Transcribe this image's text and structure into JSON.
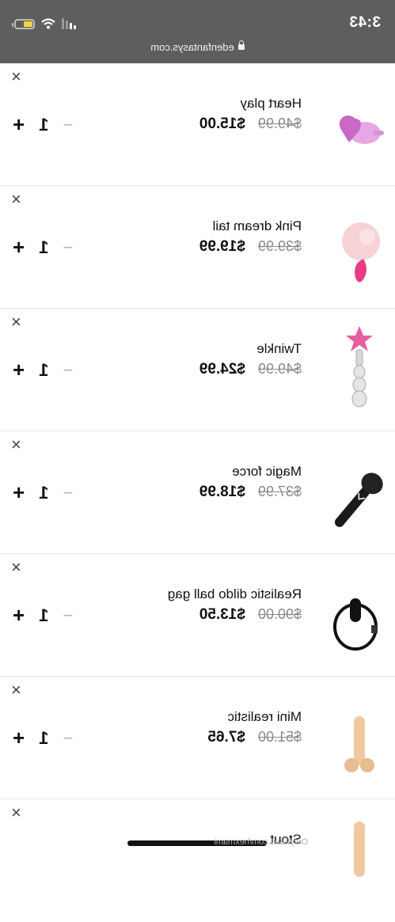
{
  "status_bar": {
    "time": "3:43",
    "url": "edenfantasys.com"
  },
  "cart_items": [
    {
      "name": "Heart play",
      "old_price": "$49.99",
      "price": "$15.00",
      "qty": "1",
      "icon": "heart-plug-product-image"
    },
    {
      "name": "Pink dream tail",
      "old_price": "$39.99",
      "price": "$19.99",
      "qty": "1",
      "icon": "tail-plug-product-image"
    },
    {
      "name": "Twinkle",
      "old_price": "$49.99",
      "price": "$24.99",
      "qty": "1",
      "icon": "star-wand-product-image"
    },
    {
      "name": "Magic force",
      "old_price": "$37.99",
      "price": "$18.99",
      "qty": "1",
      "icon": "wand-massager-product-image"
    },
    {
      "name": "Realistic dildo ball gag",
      "old_price": "$90.00",
      "price": "$13.50",
      "qty": "1",
      "icon": "ball-gag-product-image"
    },
    {
      "name": "Mini realistic",
      "old_price": "$51.00",
      "price": "$7.65",
      "qty": "1",
      "icon": "realistic-toy-product-image"
    },
    {
      "name": "Stout",
      "old_price": "",
      "price": "",
      "qty": "",
      "icon": "realistic-toy-product-image"
    }
  ],
  "controls": {
    "remove": "×",
    "minus": "−",
    "plus": "+"
  },
  "watermark": "OnlyFans.com/hexmami",
  "colors": {
    "status_bar": "#5e5e5e",
    "old_price": "#8a8a8a",
    "battery": "#f1d63b"
  }
}
